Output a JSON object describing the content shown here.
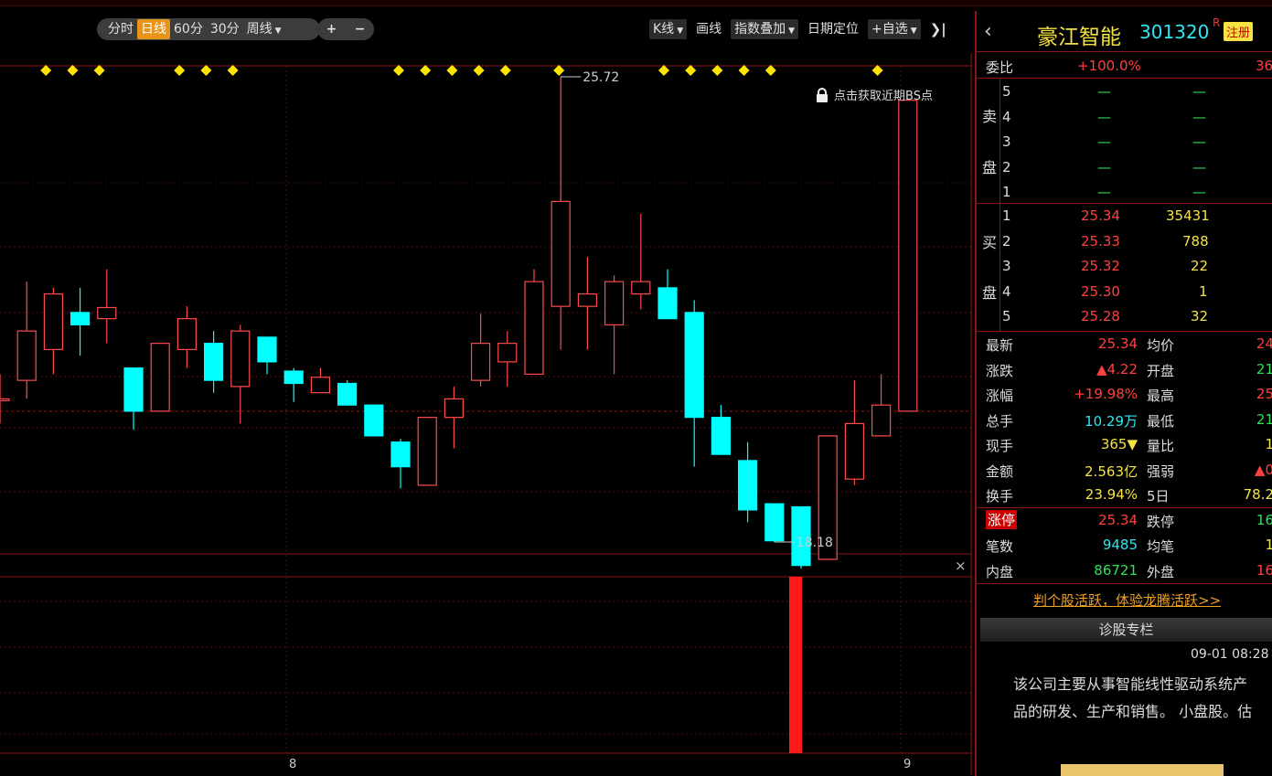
{
  "toolbar": {
    "periods": [
      "分时",
      "日线",
      "60分",
      "30分",
      "周线"
    ],
    "active_period": "日线",
    "zoom_in": "+",
    "zoom_out": "−",
    "right_buttons": [
      "K线",
      "画线",
      "指数叠加",
      "日期定位",
      "+自选"
    ],
    "collapse_icon": "❯|"
  },
  "chart": {
    "high_label": "25.72",
    "low_label": "18.18",
    "bs_hint": "点击获取近期BS点",
    "x_labels": [
      "8",
      "9"
    ],
    "close_icon": "×"
  },
  "candles": [
    {
      "o": 20.5,
      "c": 20.5,
      "h": 20.9,
      "l": 20.1
    },
    {
      "o": 20.8,
      "c": 21.6,
      "h": 22.4,
      "l": 20.5
    },
    {
      "o": 21.3,
      "c": 22.2,
      "h": 22.3,
      "l": 20.9
    },
    {
      "o": 21.9,
      "c": 21.7,
      "h": 22.3,
      "l": 21.2
    },
    {
      "o": 21.8,
      "c": 21.98,
      "h": 22.6,
      "l": 21.4
    },
    {
      "o": 21.0,
      "c": 20.3,
      "h": 21.0,
      "l": 20.0
    },
    {
      "o": 20.3,
      "c": 21.4,
      "h": 21.4,
      "l": 20.3
    },
    {
      "o": 21.3,
      "c": 21.8,
      "h": 22.0,
      "l": 21.0
    },
    {
      "o": 21.4,
      "c": 20.8,
      "h": 21.6,
      "l": 20.6
    },
    {
      "o": 20.7,
      "c": 21.6,
      "h": 21.7,
      "l": 20.1
    },
    {
      "o": 21.5,
      "c": 21.1,
      "h": 21.5,
      "l": 20.9
    },
    {
      "o": 20.95,
      "c": 20.75,
      "h": 21.0,
      "l": 20.45
    },
    {
      "o": 20.6,
      "c": 20.85,
      "h": 21.0,
      "l": 20.6
    },
    {
      "o": 20.75,
      "c": 20.4,
      "h": 20.8,
      "l": 20.4
    },
    {
      "o": 20.4,
      "c": 19.9,
      "h": 20.4,
      "l": 19.9
    },
    {
      "o": 19.8,
      "c": 19.4,
      "h": 19.85,
      "l": 19.05
    },
    {
      "o": 19.1,
      "c": 20.2,
      "h": 20.2,
      "l": 19.1
    },
    {
      "o": 20.2,
      "c": 20.5,
      "h": 20.7,
      "l": 19.7
    },
    {
      "o": 20.8,
      "c": 21.4,
      "h": 21.88,
      "l": 20.7
    },
    {
      "o": 21.1,
      "c": 21.4,
      "h": 21.6,
      "l": 20.7
    },
    {
      "o": 20.9,
      "c": 22.4,
      "h": 22.6,
      "l": 20.9
    },
    {
      "o": 22.0,
      "c": 23.7,
      "h": 25.72,
      "l": 21.3
    },
    {
      "o": 22.0,
      "c": 22.2,
      "h": 22.8,
      "l": 21.3
    },
    {
      "o": 21.7,
      "c": 22.4,
      "h": 22.5,
      "l": 20.9
    },
    {
      "o": 22.2,
      "c": 22.4,
      "h": 23.5,
      "l": 21.95
    },
    {
      "o": 22.3,
      "c": 21.8,
      "h": 22.6,
      "l": 21.8
    },
    {
      "o": 21.9,
      "c": 20.2,
      "h": 22.1,
      "l": 19.4
    },
    {
      "o": 20.2,
      "c": 19.6,
      "h": 20.4,
      "l": 19.6
    },
    {
      "o": 19.5,
      "c": 18.7,
      "h": 19.8,
      "l": 18.5
    },
    {
      "o": 18.8,
      "c": 18.2,
      "h": 18.8,
      "l": 18.18
    },
    {
      "o": 18.75,
      "c": 17.8,
      "h": 18.75,
      "l": 17.75
    },
    {
      "o": 17.9,
      "c": 19.9,
      "h": 19.9,
      "l": 17.9
    },
    {
      "o": 19.2,
      "c": 20.1,
      "h": 20.8,
      "l": 19.1
    },
    {
      "o": 19.9,
      "c": 20.4,
      "h": 20.9,
      "l": 19.9
    },
    {
      "o": 20.3,
      "c": 25.34,
      "h": 25.34,
      "l": 20.3
    }
  ],
  "diamond_indices": [
    1,
    2,
    3,
    6,
    7,
    8,
    15,
    16,
    17,
    18,
    19,
    21,
    25,
    26,
    27,
    28,
    29,
    33
  ],
  "panel": {
    "name": "豪江智能",
    "code": "301320",
    "r_mark": "R",
    "register_badge": "注册",
    "ratio_label": "委比",
    "ratio_value": "+100.0%",
    "ratio_extra": "36",
    "sell_label_top": "卖",
    "sell_label_bottom": "盘",
    "buy_label_top": "买",
    "buy_label_bottom": "盘",
    "sell": [
      {
        "lv": "5",
        "price": "—",
        "vol": "—"
      },
      {
        "lv": "4",
        "price": "—",
        "vol": "—"
      },
      {
        "lv": "3",
        "price": "—",
        "vol": "—"
      },
      {
        "lv": "2",
        "price": "—",
        "vol": "—"
      },
      {
        "lv": "1",
        "price": "—",
        "vol": "—"
      }
    ],
    "buy": [
      {
        "lv": "1",
        "price": "25.34",
        "vol": "35431"
      },
      {
        "lv": "2",
        "price": "25.33",
        "vol": "788"
      },
      {
        "lv": "3",
        "price": "25.32",
        "vol": "22"
      },
      {
        "lv": "4",
        "price": "25.30",
        "vol": "1"
      },
      {
        "lv": "5",
        "price": "25.28",
        "vol": "32"
      }
    ],
    "stats": [
      {
        "l1": "最新",
        "v1": "25.34",
        "c1": "red",
        "l2": "均价",
        "v2": "24",
        "c2": "red"
      },
      {
        "l1": "涨跌",
        "v1": "▲4.22",
        "c1": "red",
        "l2": "开盘",
        "v2": "21",
        "c2": "green"
      },
      {
        "l1": "涨幅",
        "v1": "+19.98%",
        "c1": "red",
        "l2": "最高",
        "v2": "25",
        "c2": "red"
      },
      {
        "l1": "总手",
        "v1": "10.29万",
        "c1": "cyan",
        "l2": "最低",
        "v2": "21",
        "c2": "green"
      },
      {
        "l1": "现手",
        "v1": "365▼",
        "c1": "yel",
        "l2": "量比",
        "v2": "1",
        "c2": "yel"
      },
      {
        "l1": "金额",
        "v1": "2.563亿",
        "c1": "yel",
        "l2": "强弱",
        "v2": "▲0",
        "c2": "red"
      },
      {
        "l1": "换手",
        "v1": "23.94%",
        "c1": "yel",
        "l2": "5日",
        "v2": "78.2",
        "c2": "yel"
      },
      {
        "l1": "涨停",
        "v1": "25.34",
        "c1": "red",
        "l2": "跌停",
        "v2": "16",
        "c2": "green"
      },
      {
        "l1": "笔数",
        "v1": "9485",
        "c1": "cyan",
        "l2": "均笔",
        "v2": "1",
        "c2": "yel"
      },
      {
        "l1": "内盘",
        "v1": "86721",
        "c1": "green",
        "l2": "外盘",
        "v2": "16",
        "c2": "red"
      }
    ],
    "promo": "判个股活跃，体验龙腾活跃>>",
    "column_title": "诊股专栏",
    "news_time": "09-01 08:28",
    "news_line1": "该公司主要从事智能线性驱动系统产",
    "news_line2": "品的研发、生产和销售。 小盘股。估"
  },
  "colors": {
    "up": "#ff4a4a",
    "down": "#00ffff",
    "grid": "#8a1515",
    "diamond": "#ffe600"
  }
}
